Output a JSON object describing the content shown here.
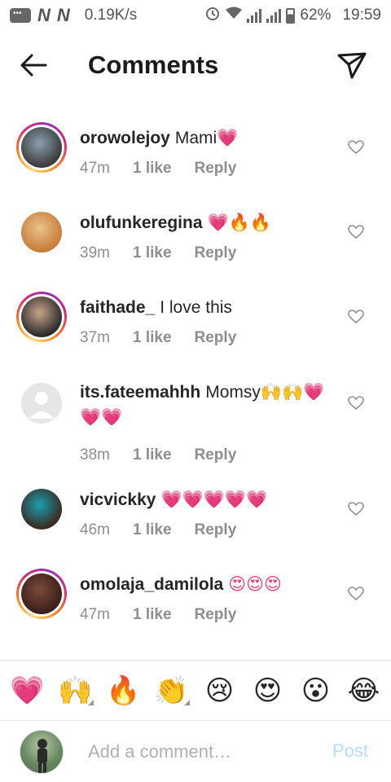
{
  "status_bar": {
    "net1": "N",
    "net2": "N",
    "speed": "0.19K/s",
    "battery": "62%",
    "time": "19:59"
  },
  "header": {
    "title": "Comments"
  },
  "comments": [
    {
      "username": "orowolejoy",
      "text": "Mami",
      "emoji": "💗",
      "time": "47m",
      "likes": "1 like",
      "reply": "Reply",
      "story_ring": true,
      "avatar_colors": [
        "#3b3b3b",
        "#8aa0b0"
      ]
    },
    {
      "username": "olufunkeregina",
      "text": "",
      "emoji": "💗🔥🔥",
      "time": "39m",
      "likes": "1 like",
      "reply": "Reply",
      "story_ring": false,
      "avatar_colors": [
        "#c97b3a",
        "#e8c48a"
      ]
    },
    {
      "username": "faithade_",
      "text": "I love this",
      "emoji": "",
      "time": "37m",
      "likes": "1 like",
      "reply": "Reply",
      "story_ring": true,
      "avatar_colors": [
        "#2a2a2a",
        "#c9a48a"
      ]
    },
    {
      "username": "its.fateemahhh",
      "text": "Momsy",
      "emoji": "🙌🙌💗💗💗",
      "time": "38m",
      "likes": "1 like",
      "reply": "Reply",
      "story_ring": false,
      "avatar_colors": [
        "#e6e6e6",
        "#ffffff"
      ]
    },
    {
      "username": "vicvickky",
      "text": "",
      "emoji": "💗💗💗💗💗",
      "time": "46m",
      "likes": "1 like",
      "reply": "Reply",
      "story_ring": false,
      "avatar_colors": [
        "#3a2a22",
        "#1a9fb0"
      ]
    },
    {
      "username": "omolaja_damilola",
      "text": "",
      "emoji": "😍😍😍",
      "time": "47m",
      "likes": "1 like",
      "reply": "Reply",
      "story_ring": true,
      "avatar_colors": [
        "#3a1f1a",
        "#7a4a3a"
      ]
    }
  ],
  "emoji_bar": [
    {
      "glyph": "💗",
      "name": "heart-emoji",
      "variants": false
    },
    {
      "glyph": "🙌",
      "name": "raising-hands-emoji",
      "variants": true
    },
    {
      "glyph": "🔥",
      "name": "fire-emoji",
      "variants": false
    },
    {
      "glyph": "👏",
      "name": "clapping-hands-emoji",
      "variants": true
    },
    {
      "glyph": "😢",
      "name": "crying-face-emoji",
      "variants": false
    },
    {
      "glyph": "😍",
      "name": "heart-eyes-emoji",
      "variants": false
    },
    {
      "glyph": "😮",
      "name": "surprised-face-emoji",
      "variants": false
    },
    {
      "glyph": "😂",
      "name": "laughing-face-emoji",
      "variants": false
    }
  ],
  "composer": {
    "placeholder": "Add a comment…",
    "post_label": "Post"
  },
  "colors": {
    "story_ring": "#d62976",
    "meta_text": "#8e8e8e",
    "post_disabled": "#b2dffc"
  }
}
